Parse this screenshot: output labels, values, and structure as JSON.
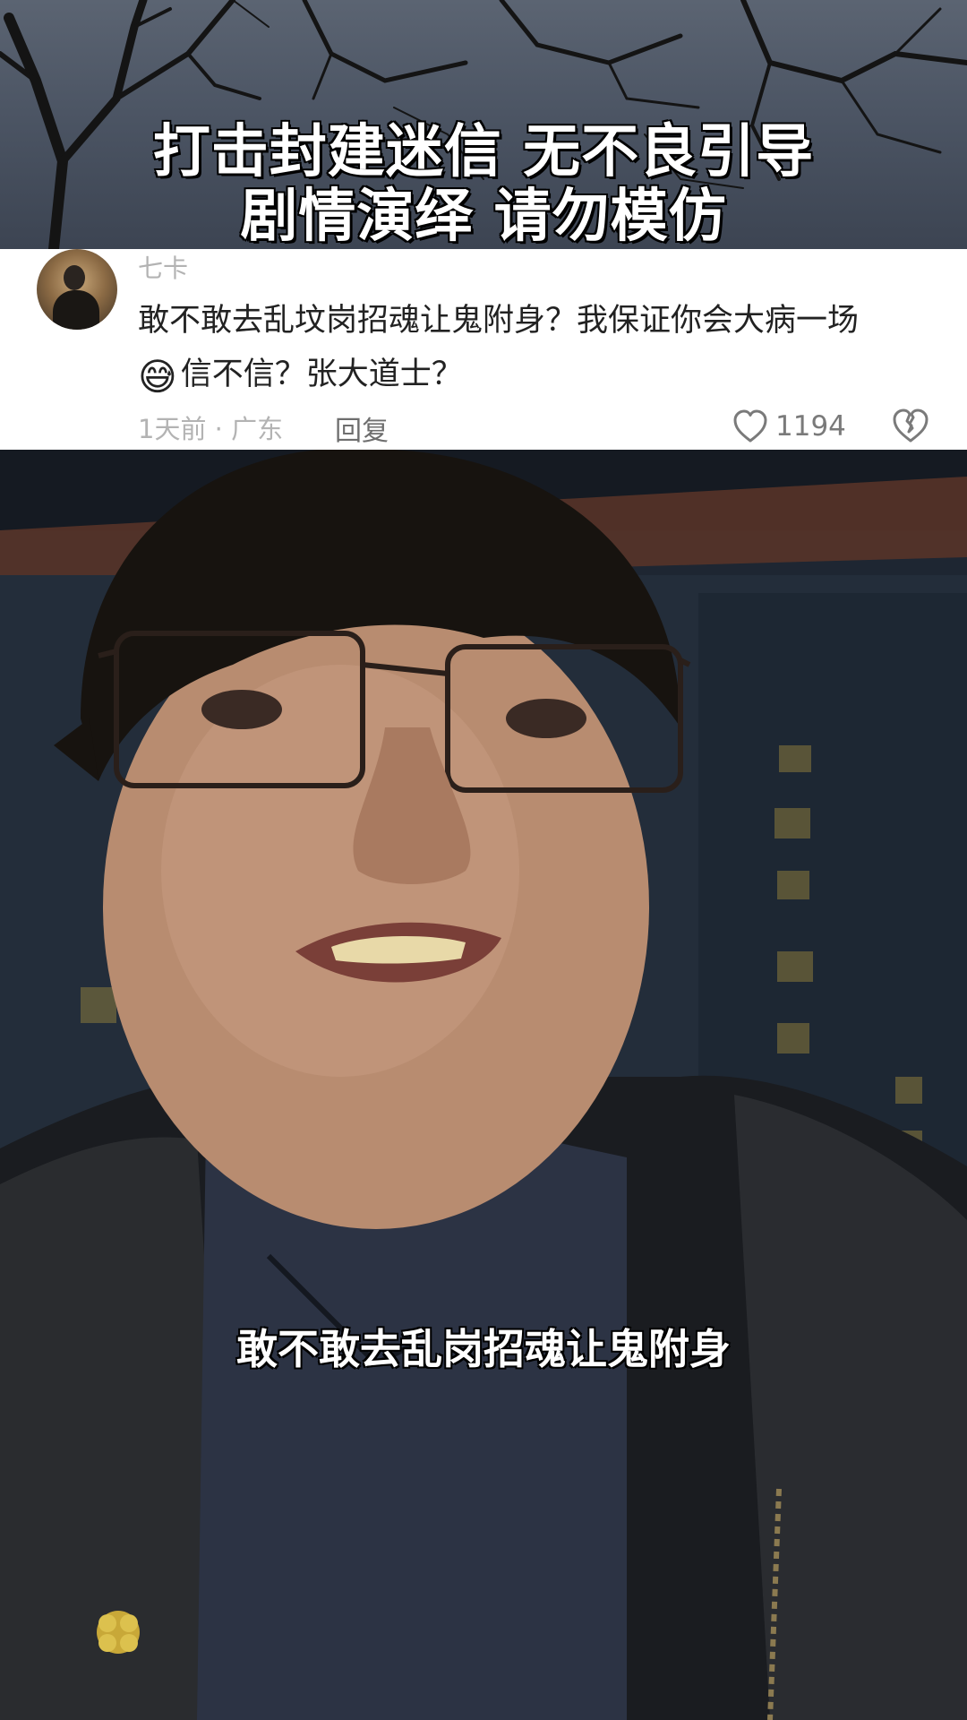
{
  "top_video": {
    "banner_line1": "打击封建迷信 无不良引导",
    "banner_line2": "剧情演绎 请勿模仿"
  },
  "comment": {
    "username": "七卡",
    "text_line1": "敢不敢去乱坟岗招魂让鬼附身？我保证你会大病一场",
    "emoji": "😅",
    "text_line2": "信不信？张大道士？",
    "meta": "1天前 · 广东",
    "reply_label": "回复",
    "like_count": "1194",
    "like_icon": "heart-outline-icon",
    "dislike_icon": "broken-heart-icon"
  },
  "main_video": {
    "subtitle": "敢不敢去乱岗招魂让鬼附身"
  }
}
